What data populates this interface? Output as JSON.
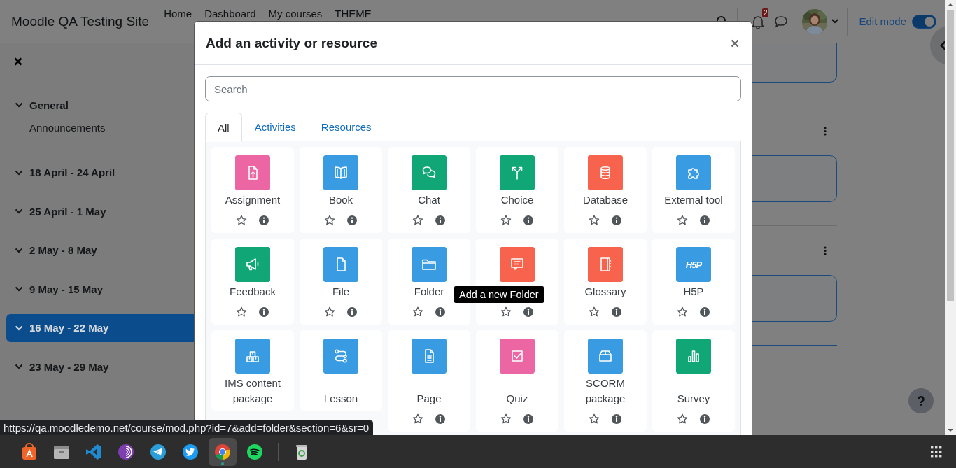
{
  "navbar": {
    "site_name": "Moodle QA Testing Site",
    "links": [
      "Home",
      "Dashboard",
      "My courses",
      "THEME"
    ],
    "notification_count": "2",
    "edit_mode": {
      "label": "Edit mode",
      "on": true
    }
  },
  "course_index": {
    "sections": [
      {
        "title": "General",
        "expanded": true,
        "selected": false,
        "children": [
          {
            "title": "Announcements"
          }
        ]
      },
      {
        "title": "18 April - 24 April",
        "expanded": true,
        "selected": false
      },
      {
        "title": "25 April - 1 May",
        "expanded": true,
        "selected": false
      },
      {
        "title": "2 May - 8 May",
        "expanded": true,
        "selected": false
      },
      {
        "title": "9 May - 15 May",
        "expanded": true,
        "selected": false
      },
      {
        "title": "16 May - 22 May",
        "expanded": true,
        "selected": true
      },
      {
        "title": "23 May - 29 May",
        "expanded": true,
        "selected": false
      }
    ]
  },
  "modal": {
    "title": "Add an activity or resource",
    "search": {
      "placeholder": "Search"
    },
    "tabs": [
      {
        "label": "All",
        "selected": true
      },
      {
        "label": "Activities",
        "selected": false
      },
      {
        "label": "Resources",
        "selected": false
      }
    ],
    "items": [
      {
        "name": "Assignment",
        "kind": "assignment",
        "color": "#eb66a2",
        "starred": false
      },
      {
        "name": "Book",
        "kind": "book",
        "color": "#399be2",
        "starred": false
      },
      {
        "name": "Chat",
        "kind": "chat",
        "color": "#11a676",
        "starred": false
      },
      {
        "name": "Choice",
        "kind": "choice",
        "color": "#11a676",
        "starred": false
      },
      {
        "name": "Database",
        "kind": "database",
        "color": "#f7634d",
        "starred": false
      },
      {
        "name": "External tool",
        "kind": "puzzle",
        "color": "#399be2",
        "starred": false
      },
      {
        "name": "Feedback",
        "kind": "megaphone",
        "color": "#11a676",
        "starred": false
      },
      {
        "name": "File",
        "kind": "file",
        "color": "#399be2",
        "starred": false
      },
      {
        "name": "Folder",
        "kind": "folder",
        "color": "#399be2",
        "starred": false
      },
      {
        "kind": "forum",
        "color": "#f7634d",
        "starred": false
      },
      {
        "name": "Glossary",
        "kind": "glossary",
        "color": "#f7634d",
        "starred": false
      },
      {
        "name": "H5P",
        "kind": "h5p",
        "icon_text": "H5P",
        "color": "#399be2",
        "starred": false
      },
      {
        "name": "IMS content package",
        "kind": "boxes",
        "color": "#399be2"
      },
      {
        "name": "Lesson",
        "kind": "lesson",
        "color": "#399be2"
      },
      {
        "name": "Page",
        "kind": "page",
        "color": "#399be2",
        "starred": false
      },
      {
        "name": "Quiz",
        "kind": "quiz",
        "color": "#eb66a2",
        "starred": false
      },
      {
        "name": "SCORM package",
        "kind": "package",
        "color": "#399be2",
        "starred": false
      },
      {
        "name": "Survey",
        "kind": "survey",
        "color": "#11a676",
        "starred": false
      }
    ],
    "tooltip": "Add a new Folder"
  },
  "status_url": "https://qa.moodledemo.net/course/mod.php?id=7&add=folder&section=6&sr=0",
  "taskbar": {
    "apps": [
      {
        "kind": "store",
        "active": false
      },
      {
        "kind": "files",
        "active": false
      },
      {
        "kind": "code",
        "active": false
      },
      {
        "kind": "tor",
        "active": false
      },
      {
        "kind": "telegram",
        "active": false
      },
      {
        "kind": "bird",
        "active": false
      },
      {
        "kind": "chrome",
        "active": true
      },
      {
        "kind": "spotify",
        "active": false
      },
      {
        "kind": "separator"
      },
      {
        "kind": "trash",
        "active": false
      }
    ]
  }
}
